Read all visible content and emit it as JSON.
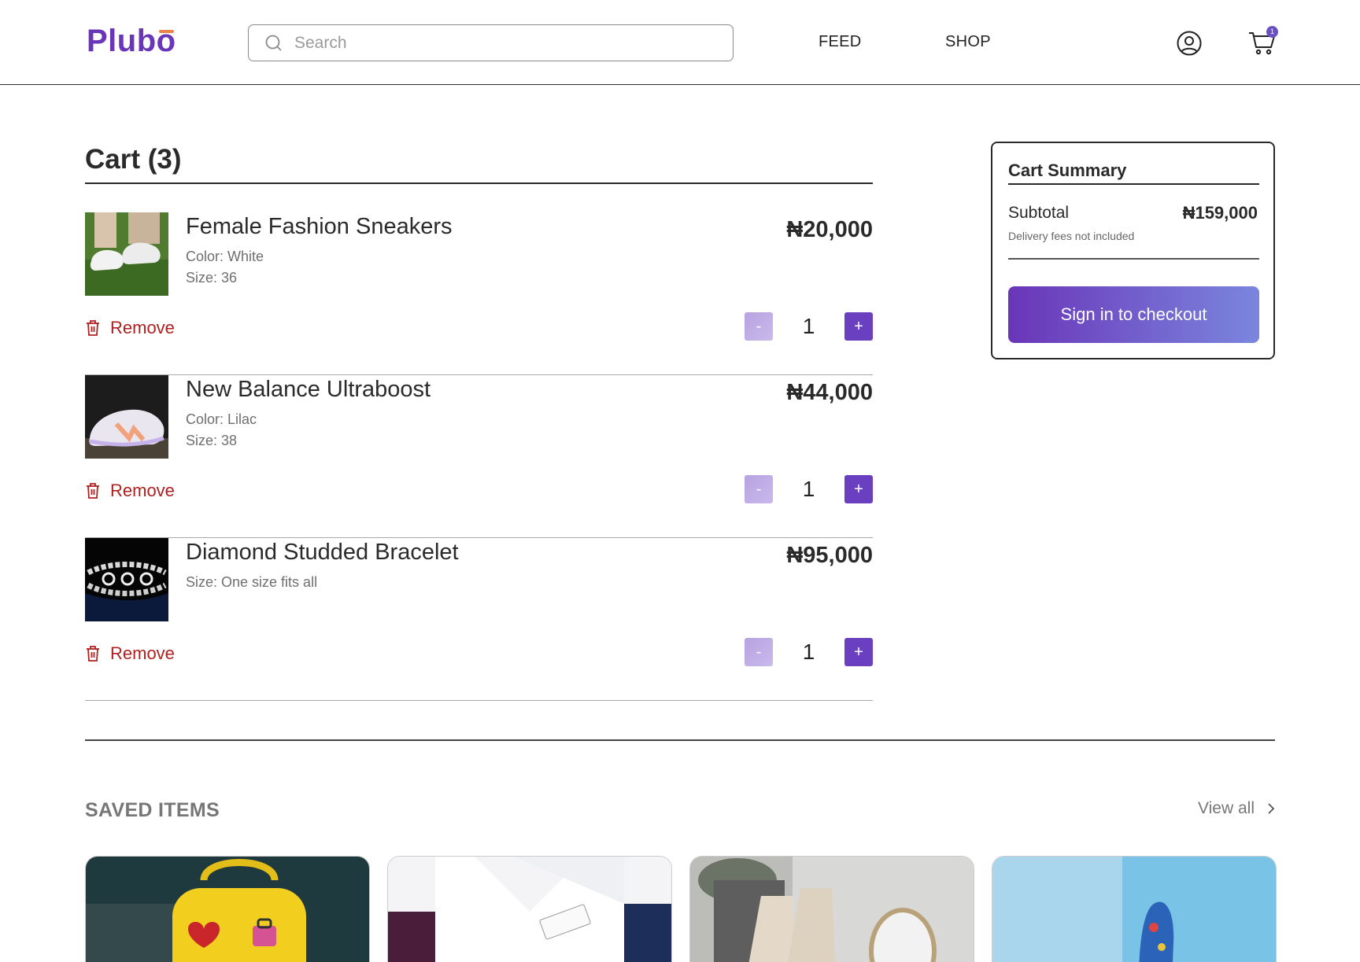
{
  "header": {
    "logo": "Plubo",
    "search_placeholder": "Search",
    "nav": [
      "FEED",
      "SHOP"
    ],
    "cart_count": "1"
  },
  "cart": {
    "title": "Cart (3)",
    "items": [
      {
        "name": "Female Fashion Sneakers",
        "meta": [
          "Color: White",
          "Size: 36"
        ],
        "price": "₦20,000",
        "qty": "1",
        "remove_label": "Remove",
        "minus": "-",
        "plus": "+"
      },
      {
        "name": "New Balance Ultraboost",
        "meta": [
          "Color: Lilac",
          "Size: 38"
        ],
        "price": "₦44,000",
        "qty": "1",
        "remove_label": "Remove",
        "minus": "-",
        "plus": "+"
      },
      {
        "name": "Diamond Studded Bracelet",
        "meta": [
          "Size: One size fits all"
        ],
        "price": "₦95,000",
        "qty": "1",
        "remove_label": "Remove",
        "minus": "-",
        "plus": "+"
      }
    ]
  },
  "summary": {
    "title": "Cart Summary",
    "subtotal_label": "Subtotal",
    "subtotal_value": "₦159,000",
    "delivery_note": "Delivery fees not included",
    "checkout_label": "Sign in to checkout"
  },
  "saved": {
    "title": "SAVED ITEMS",
    "view_all": "View all"
  },
  "colors": {
    "brand": "#6a35b8",
    "accent": "#e8834b",
    "remove": "#b02020"
  }
}
